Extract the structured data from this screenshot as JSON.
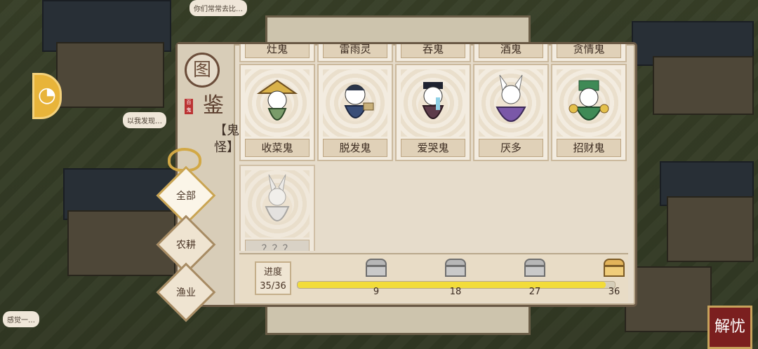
{
  "overlay_signs": [
    {
      "text": "你们常常去比…"
    },
    {
      "text": "以我发现…"
    },
    {
      "text": "感觉一…"
    }
  ],
  "left_button_icon": "coin-icon",
  "album": {
    "title_seal": "图",
    "title_char": "鉴",
    "stamp": "百鬼",
    "category_label": "【鬼怪】",
    "filters": [
      {
        "label": "全部",
        "active": true
      },
      {
        "label": "农耕",
        "active": false
      },
      {
        "label": "渔业",
        "active": false
      }
    ],
    "top_partial_names": [
      "灶鬼",
      "雷雨灵",
      "吞鬼",
      "酒鬼",
      "贪情鬼"
    ],
    "cards": [
      {
        "name": "收菜鬼",
        "unlocked": true,
        "color": "#7a9c6a"
      },
      {
        "name": "脱发鬼",
        "unlocked": true,
        "color": "#3a4e77"
      },
      {
        "name": "爱哭鬼",
        "unlocked": true,
        "color": "#5d3c4a"
      },
      {
        "name": "厌多",
        "unlocked": true,
        "color": "#7a58a8"
      },
      {
        "name": "招财鬼",
        "unlocked": true,
        "color": "#3f8a56"
      },
      {
        "name": "？？？",
        "unlocked": false,
        "color": "#cfcfcf"
      }
    ],
    "progress": {
      "label": "进度",
      "value_text": "35/36",
      "current": 35,
      "total": 36,
      "milestones": [
        9,
        18,
        27,
        36
      ]
    }
  },
  "corner_button": "解忧"
}
